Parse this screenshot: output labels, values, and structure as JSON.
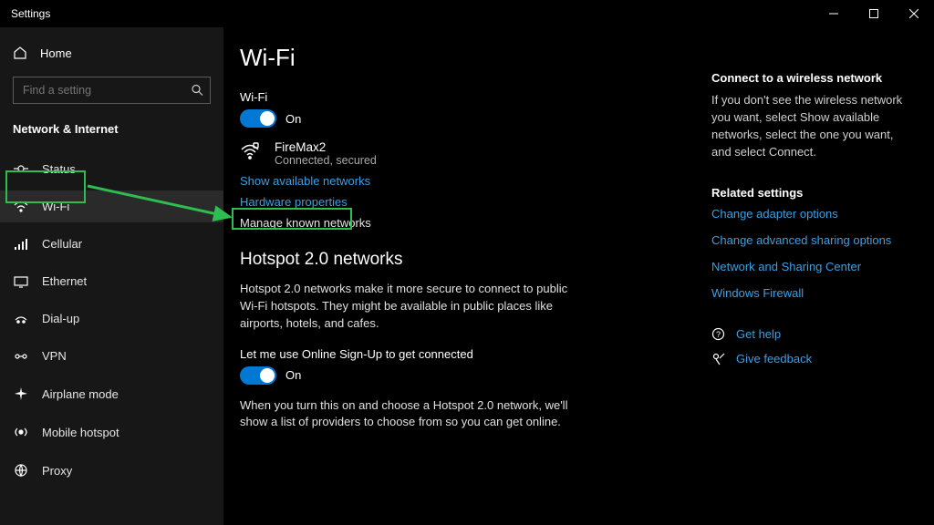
{
  "title": "Settings",
  "sidebar": {
    "home": "Home",
    "search_placeholder": "Find a setting",
    "category": "Network & Internet",
    "items": [
      {
        "label": "Status"
      },
      {
        "label": "Wi-Fi"
      },
      {
        "label": "Cellular"
      },
      {
        "label": "Ethernet"
      },
      {
        "label": "Dial-up"
      },
      {
        "label": "VPN"
      },
      {
        "label": "Airplane mode"
      },
      {
        "label": "Mobile hotspot"
      },
      {
        "label": "Proxy"
      }
    ]
  },
  "page": {
    "title": "Wi-Fi",
    "wifi_label": "Wi-Fi",
    "wifi_state": "On",
    "network": {
      "name": "FireMax2",
      "status": "Connected, secured"
    },
    "links": {
      "show_available": "Show available networks",
      "hw_props": "Hardware properties",
      "manage_known": "Manage known networks"
    },
    "hotspot": {
      "heading": "Hotspot 2.0 networks",
      "desc": "Hotspot 2.0 networks make it more secure to connect to public Wi-Fi hotspots. They might be available in public places like airports, hotels, and cafes.",
      "signup_label": "Let me use Online Sign-Up to get connected",
      "signup_state": "On",
      "signup_desc": "When you turn this on and choose a Hotspot 2.0 network, we'll show a list of providers to choose from so you can get online."
    }
  },
  "right": {
    "connect_head": "Connect to a wireless network",
    "connect_text": "If you don't see the wireless network you want, select Show available networks, select the one you want, and select Connect.",
    "related_head": "Related settings",
    "related": [
      "Change adapter options",
      "Change advanced sharing options",
      "Network and Sharing Center",
      "Windows Firewall"
    ],
    "help": "Get help",
    "feedback": "Give feedback"
  }
}
